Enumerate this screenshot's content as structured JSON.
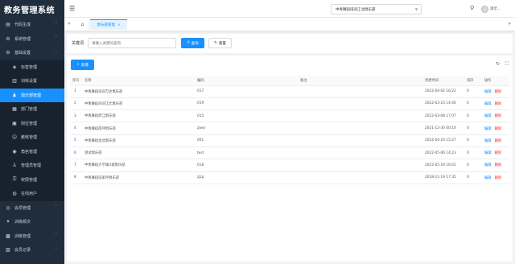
{
  "app": {
    "title": "教务管理系统"
  },
  "sidebar": {
    "items": [
      {
        "label": "代码生成",
        "icon": "code-icon",
        "level": 1,
        "arrow": "down"
      },
      {
        "label": "系统管理",
        "icon": "gear-icon",
        "level": 1,
        "arrow": "down"
      },
      {
        "label": "基础设置",
        "icon": "settings-icon",
        "level": 1,
        "arrow": "up"
      },
      {
        "label": "标签管理",
        "icon": "tag-icon",
        "level": 2
      },
      {
        "label": "训练设置",
        "icon": "document-icon",
        "level": 2
      },
      {
        "label": "俱乐部管理",
        "icon": "person-icon",
        "level": 2,
        "active": true
      },
      {
        "label": "部门管理",
        "icon": "department-icon",
        "level": 2
      },
      {
        "label": "岗位管理",
        "icon": "position-icon",
        "level": 2
      },
      {
        "label": "教练管理",
        "icon": "coach-icon",
        "level": 2
      },
      {
        "label": "角色管理",
        "icon": "role-icon",
        "level": 2
      },
      {
        "label": "管理员管理",
        "icon": "admin-icon",
        "level": 2
      },
      {
        "label": "权限管理",
        "icon": "permission-icon",
        "level": 2
      },
      {
        "label": "在线用户",
        "icon": "online-user-icon",
        "level": 2
      },
      {
        "label": "会员管理",
        "icon": "member-icon",
        "level": 1,
        "arrow": "down"
      },
      {
        "label": "训练频次",
        "icon": "frequency-icon",
        "level": 1
      },
      {
        "label": "训练管理",
        "icon": "training-icon",
        "level": 1,
        "arrow": "down"
      },
      {
        "label": "会员记录",
        "icon": "record-icon",
        "level": 1,
        "arrow": "down"
      }
    ]
  },
  "navbar": {
    "org_select": "中青舞蹈培训江北俱乐部",
    "user_name": "演示..."
  },
  "tags": {
    "active_label": "俱乐部管理"
  },
  "query": {
    "keyword_label": "关键词",
    "keyword_placeholder": "请输入关键词查询",
    "query_button": "查询",
    "reset_button": "重置"
  },
  "toolbar": {
    "add_button": "新增"
  },
  "table": {
    "columns": [
      "序号",
      "名称",
      "编码",
      "备注",
      "创建时间",
      "排序",
      "操作"
    ],
    "rows": [
      {
        "seq": "1",
        "name": "中青舞蹈培训万达俱乐部",
        "code": "017",
        "remark": "",
        "created": "2022-04-02 16:22",
        "sort": "0"
      },
      {
        "seq": "2",
        "name": "中青舞蹈培训江北俱乐部",
        "code": "019",
        "remark": "",
        "created": "2022-03-23 14:46",
        "sort": "0"
      },
      {
        "seq": "3",
        "name": "中青舞蹈周江俱乐部",
        "code": "015",
        "remark": "",
        "created": "2022-03-08 17:07",
        "sort": "0"
      },
      {
        "seq": "4",
        "name": "中青舞蹈南坪俱乐部",
        "code": "zjwd",
        "remark": "",
        "created": "2021-12-30 00:10",
        "sort": "0"
      },
      {
        "seq": "5",
        "name": "中青舞蹈金北俱乐部",
        "code": "001",
        "remark": "",
        "created": "2022-04-24 15:27",
        "sort": "0"
      },
      {
        "seq": "6",
        "name": "测试俱乐部",
        "code": "test",
        "remark": "",
        "created": "2022-05-06 14:23",
        "sort": "0"
      },
      {
        "seq": "7",
        "name": "中青舞蹈大学城U城俱乐部",
        "code": "018",
        "remark": "",
        "created": "2022-05-19 16:01",
        "sort": "0"
      },
      {
        "seq": "8",
        "name": "中青舞蹈培家坪俱乐部",
        "code": "zjzp",
        "remark": "",
        "created": "2018-11-19 17:35",
        "sort": "0"
      }
    ],
    "edit_label": "编辑",
    "delete_label": "删除"
  },
  "colors": {
    "sidebar_bg": "#1f2d3d",
    "accent": "#1890ff",
    "danger": "#f5222d"
  }
}
